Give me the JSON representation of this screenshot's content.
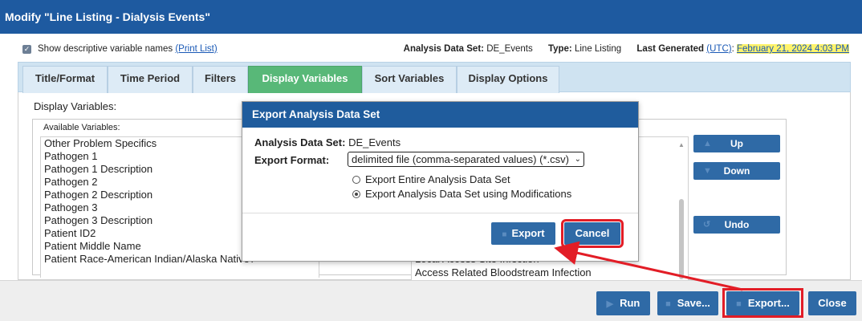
{
  "window": {
    "title": "Modify \"Line Listing - Dialysis Events\""
  },
  "options": {
    "show_names_label": "Show descriptive variable names",
    "print_list": "(Print List)",
    "analysis_label": "Analysis Data Set:",
    "analysis_value": "DE_Events",
    "type_label": "Type:",
    "type_value": "Line Listing",
    "generated_label": "Last Generated",
    "utc": "(UTC)",
    "colon": ":",
    "generated_value": "February 21, 2024 4:03 PM"
  },
  "tabs": [
    "Title/Format",
    "Time Period",
    "Filters",
    "Display Variables",
    "Sort Variables",
    "Display Options"
  ],
  "active_tab": "Display Variables",
  "display": {
    "heading": "Display Variables:",
    "available_header": "Available Variables:",
    "available": [
      "Other Problem Specifics",
      "Pathogen 1",
      "Pathogen 1 Description",
      "Pathogen 2",
      "Pathogen 2 Description",
      "Pathogen 3",
      "Pathogen 3 Description",
      "Patient ID2",
      "Patient Middle Name",
      "Patient Race-American Indian/Alaska Native?"
    ],
    "selected_visible": [
      "Local Access Site Infection",
      "Access Related Bloodstream Infection"
    ],
    "buttons": {
      "up": "Up",
      "down": "Down",
      "undo": "Undo"
    }
  },
  "footer": {
    "run": "Run",
    "save": "Save...",
    "export": "Export...",
    "close": "Close"
  },
  "modal": {
    "title": "Export Analysis Data Set",
    "ads_label": "Analysis Data Set:",
    "ads_value": "DE_Events",
    "format_label": "Export Format:",
    "format_value": "delimited file (comma-separated values) (*.csv)",
    "radio_entire": "Export Entire Analysis Data Set",
    "radio_mods": "Export Analysis Data Set using Modifications",
    "selected_radio": "radio_mods",
    "export_btn": "Export",
    "cancel_btn": "Cancel"
  },
  "colors": {
    "header": "#1e5aa0",
    "button": "#2f6aa6",
    "active_tab": "#58b878",
    "highlight": "#e21d26"
  }
}
